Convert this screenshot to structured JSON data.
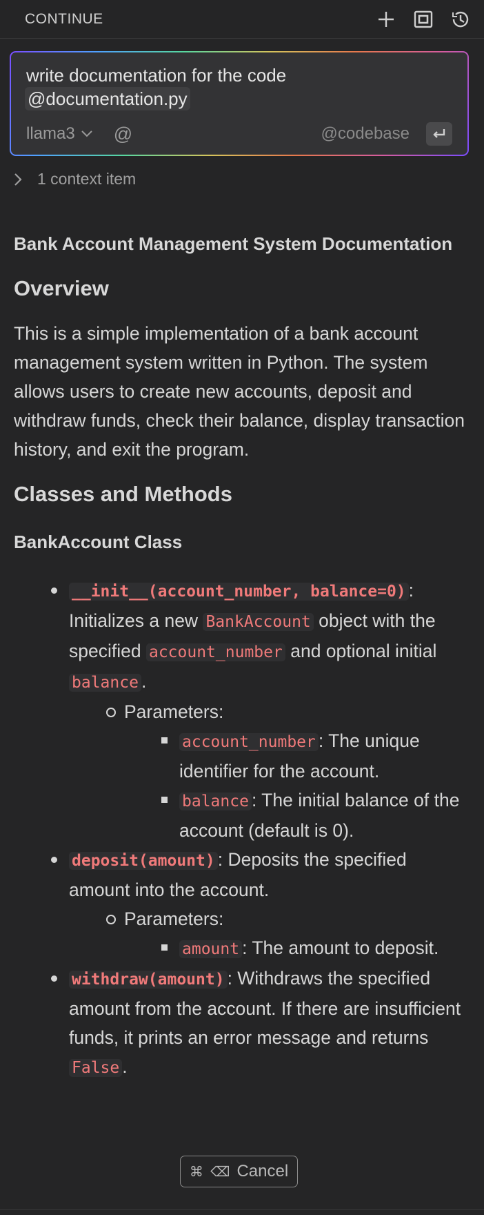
{
  "header": {
    "title": "CONTINUE",
    "icons": [
      "plus-icon",
      "fullscreen-icon",
      "history-icon"
    ]
  },
  "input": {
    "text": "write documentation for the code",
    "mention": "@documentation.py",
    "model": "llama3",
    "at_symbol": "@",
    "codebase": "@codebase",
    "enter_icon": "enter-icon"
  },
  "context": {
    "label": "1 context item"
  },
  "doc": {
    "title": "Bank Account Management System Documentation",
    "overview_heading": "Overview",
    "overview_text": "This is a simple implementation of a bank account management system written in Python. The system allows users to create new accounts, deposit and withdraw funds, check their balance, display transaction history, and exit the program.",
    "classes_heading": "Classes and Methods",
    "class_heading": "BankAccount Class",
    "methods": [
      {
        "signature": "__init__(account_number, balance=0)",
        "colon": ":",
        "desc_1": "Initializes a new",
        "code_1": "BankAccount",
        "desc_2": "object with the specified",
        "code_2": "account_number",
        "desc_3": "and optional initial",
        "code_3": "balance",
        "desc_4": ".",
        "params_label": "Parameters:",
        "params": [
          {
            "name": "account_number",
            "desc": ": The unique identifier for the account."
          },
          {
            "name": "balance",
            "desc": ": The initial balance of the account (default is 0)."
          }
        ]
      },
      {
        "signature": "deposit(amount)",
        "desc": ": Deposits the specified amount into the account.",
        "params_label": "Parameters:",
        "params": [
          {
            "name": "amount",
            "desc": ": The amount to deposit."
          }
        ]
      },
      {
        "signature": "withdraw(amount)",
        "desc": ": Withdraws the specified amount from the account. If there are insufficient funds, it prints an error message and returns",
        "code_1": "False",
        "desc_end": "."
      }
    ]
  },
  "cancel": {
    "keys": "⌘ ⌫",
    "label": "Cancel"
  }
}
